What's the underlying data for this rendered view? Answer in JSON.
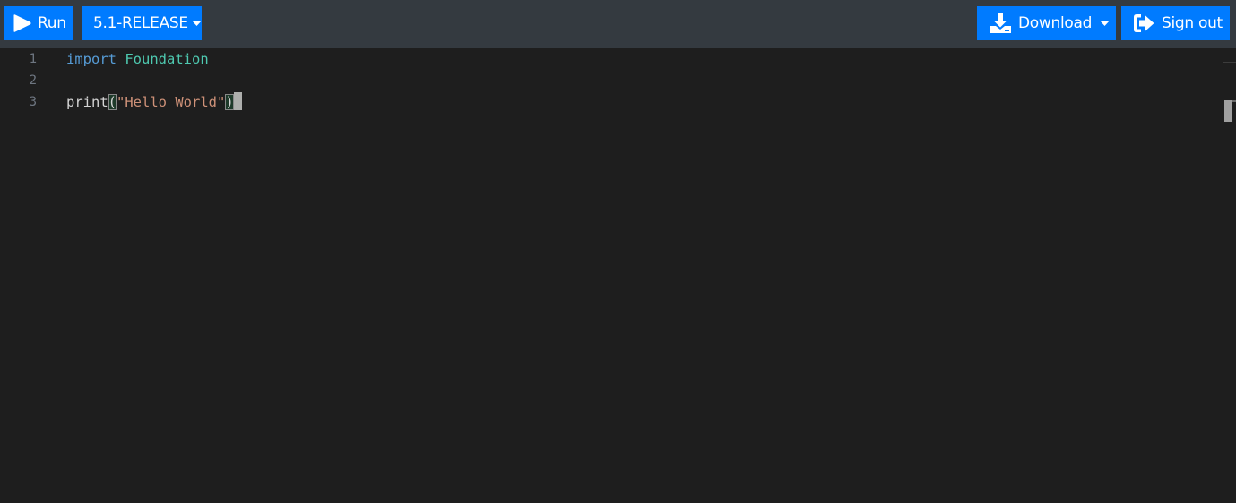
{
  "toolbar": {
    "run_label": "Run",
    "version_label": "5.1-RELEASE",
    "download_label": "Download",
    "signout_label": "Sign out",
    "icons": {
      "run": "play-icon",
      "version": "caret-down-icon",
      "download": "download-icon",
      "signout": "sign-out-icon"
    }
  },
  "editor": {
    "line_numbers": [
      "1",
      "2",
      "3"
    ],
    "lines": [
      {
        "tokens": [
          {
            "text": "import",
            "kind": "keyword"
          },
          {
            "text": " ",
            "kind": "plain"
          },
          {
            "text": "Foundation",
            "kind": "type"
          }
        ]
      },
      {
        "tokens": []
      },
      {
        "tokens": [
          {
            "text": "print",
            "kind": "function"
          },
          {
            "text": "(",
            "kind": "bracket"
          },
          {
            "text": "\"Hello World\"",
            "kind": "string"
          },
          {
            "text": ")",
            "kind": "bracket"
          }
        ]
      }
    ],
    "line1_keyword": "import",
    "line1_type": "Foundation",
    "line3_fn": "print",
    "line3_open": "(",
    "line3_string": "\"Hello World\"",
    "line3_close": ")"
  },
  "colors": {
    "accent": "#007bff",
    "toolbar_bg": "#343a40",
    "editor_bg": "#1e1e1e",
    "keyword": "#569cd6",
    "type": "#4ec9b0",
    "string": "#ce9178"
  }
}
